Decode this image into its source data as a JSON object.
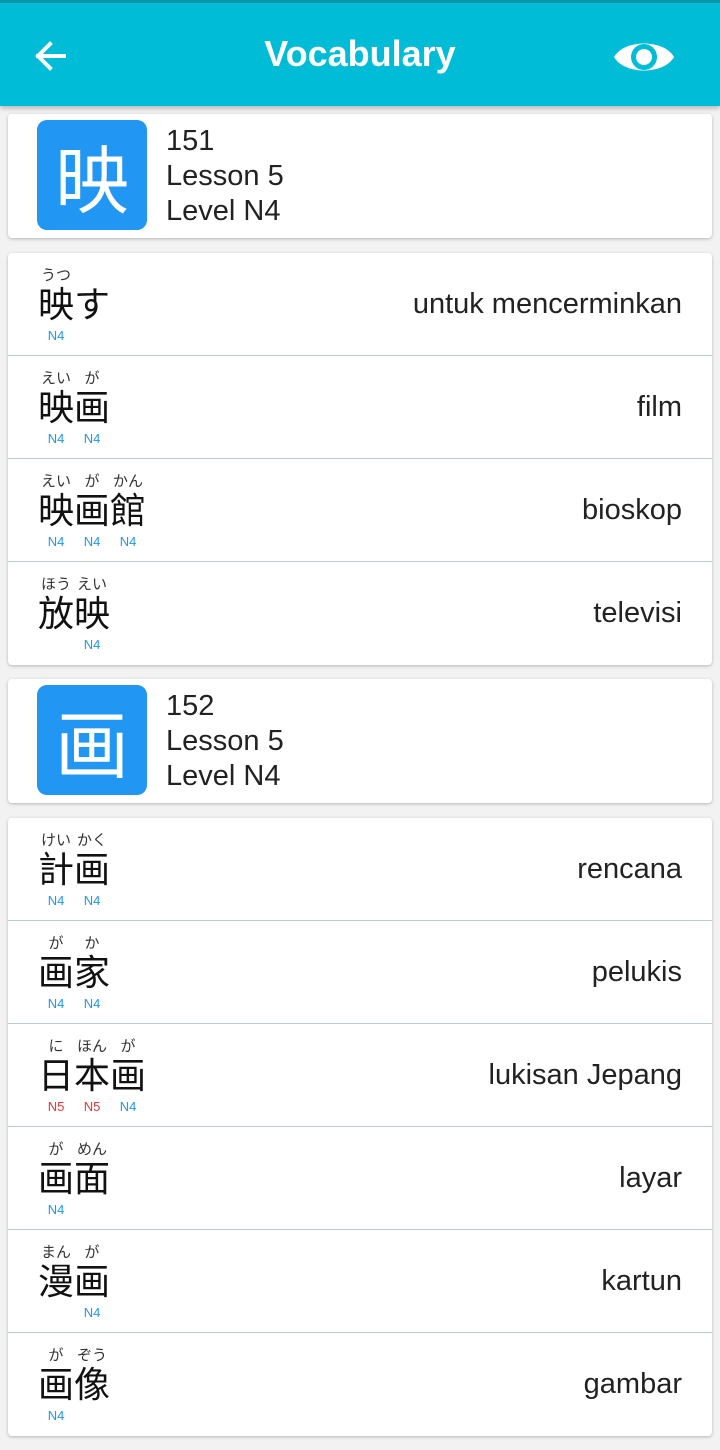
{
  "appbar": {
    "title": "Vocabulary",
    "back_icon": "arrow-left-icon",
    "view_icon": "eye-icon",
    "color": "#01bcd6"
  },
  "colors": {
    "tile": "#2196f2",
    "level_n4": "#2196f2",
    "level_n5": "#e53935"
  },
  "sections": [
    {
      "kanji": "映",
      "number": "151",
      "lesson": "Lesson 5",
      "level": "Level N4",
      "words": [
        {
          "chars": [
            {
              "k": "映",
              "f": "うつ",
              "l": "N4"
            },
            {
              "k": "す",
              "f": "",
              "l": ""
            }
          ],
          "meaning": "untuk mencerminkan"
        },
        {
          "chars": [
            {
              "k": "映",
              "f": "えい",
              "l": "N4"
            },
            {
              "k": "画",
              "f": "が",
              "l": "N4"
            }
          ],
          "meaning": "film"
        },
        {
          "chars": [
            {
              "k": "映",
              "f": "えい",
              "l": "N4"
            },
            {
              "k": "画",
              "f": "が",
              "l": "N4"
            },
            {
              "k": "館",
              "f": "かん",
              "l": "N4"
            }
          ],
          "meaning": "bioskop"
        },
        {
          "chars": [
            {
              "k": "放",
              "f": "ほう",
              "l": ""
            },
            {
              "k": "映",
              "f": "えい",
              "l": "N4"
            }
          ],
          "meaning": "televisi"
        }
      ]
    },
    {
      "kanji": "画",
      "number": "152",
      "lesson": "Lesson 5",
      "level": "Level N4",
      "words": [
        {
          "chars": [
            {
              "k": "計",
              "f": "けい",
              "l": "N4"
            },
            {
              "k": "画",
              "f": "かく",
              "l": "N4"
            }
          ],
          "meaning": "rencana"
        },
        {
          "chars": [
            {
              "k": "画",
              "f": "が",
              "l": "N4"
            },
            {
              "k": "家",
              "f": "か",
              "l": "N4"
            }
          ],
          "meaning": "pelukis"
        },
        {
          "chars": [
            {
              "k": "日",
              "f": "に",
              "l": "N5"
            },
            {
              "k": "本",
              "f": "ほん",
              "l": "N5"
            },
            {
              "k": "画",
              "f": "が",
              "l": "N4"
            }
          ],
          "meaning": "lukisan Jepang"
        },
        {
          "chars": [
            {
              "k": "画",
              "f": "が",
              "l": "N4"
            },
            {
              "k": "面",
              "f": "めん",
              "l": ""
            }
          ],
          "meaning": "layar"
        },
        {
          "chars": [
            {
              "k": "漫",
              "f": "まん",
              "l": ""
            },
            {
              "k": "画",
              "f": "が",
              "l": "N4"
            }
          ],
          "meaning": "kartun"
        },
        {
          "chars": [
            {
              "k": "画",
              "f": "が",
              "l": "N4"
            },
            {
              "k": "像",
              "f": "ぞう",
              "l": ""
            }
          ],
          "meaning": "gambar"
        }
      ]
    }
  ]
}
